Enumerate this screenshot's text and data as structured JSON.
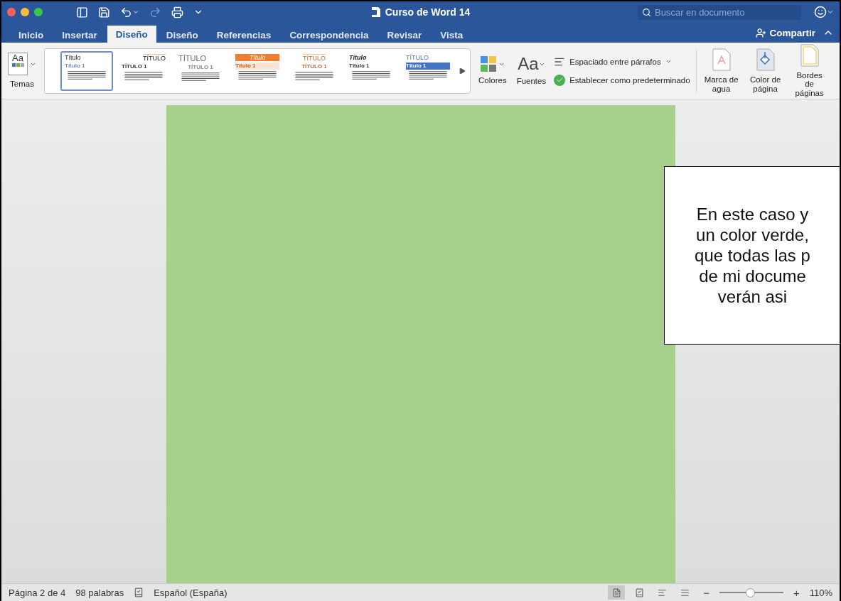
{
  "window": {
    "title": "Curso de Word 14",
    "search": {
      "placeholder": "Buscar en documento"
    }
  },
  "tabs": [
    {
      "label": "Inicio",
      "selected": false
    },
    {
      "label": "Insertar",
      "selected": false
    },
    {
      "label": "Diseño",
      "selected": true
    },
    {
      "label": "Diseño",
      "selected": false
    },
    {
      "label": "Referencias",
      "selected": false
    },
    {
      "label": "Correspondencia",
      "selected": false
    },
    {
      "label": "Revisar",
      "selected": false
    },
    {
      "label": "Vista",
      "selected": false
    }
  ],
  "share": "Compartir",
  "ribbon": {
    "themes_glyph": "Aa",
    "themes": "Temas",
    "styles": [
      {
        "kind": "basic",
        "title": "Título",
        "heading": "Título 1",
        "selected": true
      },
      {
        "kind": "lined",
        "title": "TÍTULO",
        "heading": "TÍTULO 1",
        "selected": false
      },
      {
        "kind": "light",
        "title": "TÍTULO",
        "heading": "TÍTULO 1",
        "selected": false
      },
      {
        "kind": "banded",
        "title": "Título",
        "heading": "Título 1",
        "selected": false
      },
      {
        "kind": "centered",
        "title": "TÍTULO",
        "heading": "TÍTULO 1",
        "selected": false
      },
      {
        "kind": "italic",
        "title": "Título",
        "heading": "Título 1",
        "selected": false
      },
      {
        "kind": "blue",
        "title": "TÍTULO",
        "heading": "Título 1",
        "selected": false
      }
    ],
    "colors": "Colores",
    "fonts_glyph": "Aa",
    "fonts": "Fuentes",
    "spacing": "Espaciado entre párrafos",
    "set_default": "Establecer como predeterminado",
    "page_buttons": [
      {
        "kind": "watermark",
        "label": "Marca de agua"
      },
      {
        "kind": "page-color",
        "label": "Color de página"
      },
      {
        "kind": "borders",
        "label": "Bordes de páginas"
      }
    ]
  },
  "callout": {
    "lines": [
      "En este caso y",
      "un color verde,",
      "que todas las p",
      "de mi docume",
      "verán asi"
    ]
  },
  "status_bar": {
    "page": "Página 2 de 4",
    "words": "98 palabras",
    "language": "Español (España)",
    "views": [
      {
        "selected": true
      },
      {
        "selected": false
      },
      {
        "selected": false
      },
      {
        "selected": false
      }
    ],
    "zoom": {
      "minus": "−",
      "plus": "+",
      "level": 0.48,
      "reading": "110%"
    }
  }
}
